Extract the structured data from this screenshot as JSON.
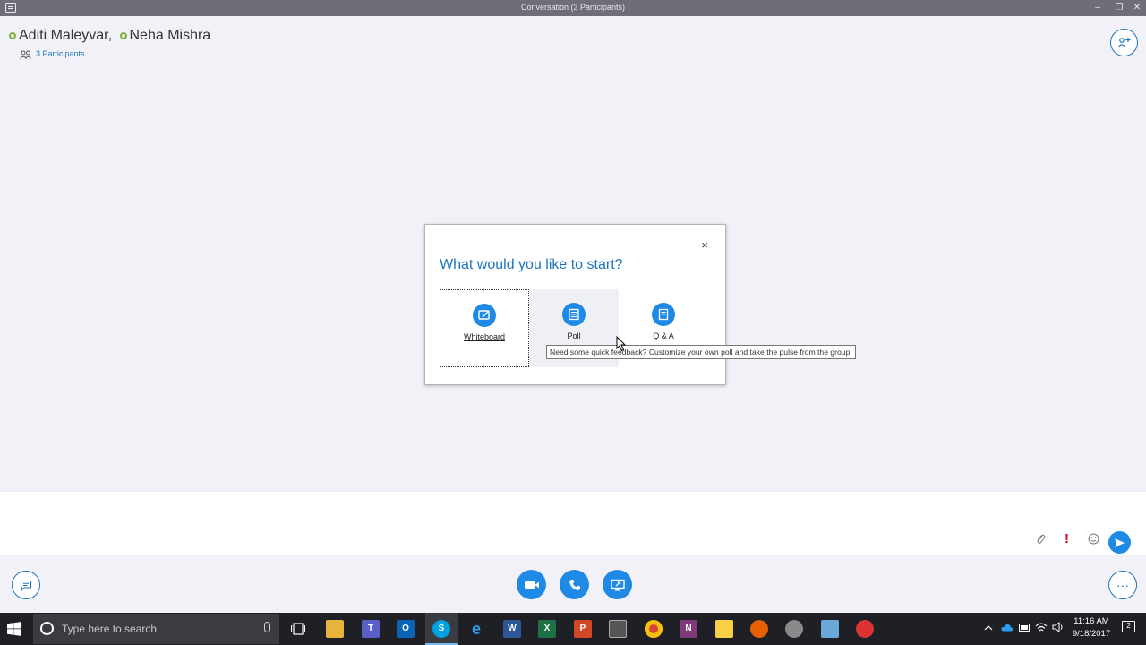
{
  "window": {
    "title": "Conversation (3 Participants)",
    "controls": {
      "minimize": "–",
      "restore": "❐",
      "close": "✕"
    }
  },
  "header": {
    "participants": [
      {
        "name": "Aditi Maleyvar,",
        "status_color": "#7db13a"
      },
      {
        "name": "Neha Mishra",
        "status_color": "#7db13a"
      }
    ],
    "participants_link": "3 Participants",
    "add_person_icon": "add-person-icon"
  },
  "dialog": {
    "heading": "What would you like to start?",
    "close_label": "×",
    "options": [
      {
        "label": "Whiteboard",
        "icon": "whiteboard-icon",
        "state": "focused"
      },
      {
        "label": "Poll",
        "icon": "poll-icon",
        "state": "hovered"
      },
      {
        "label": "Q & A",
        "icon": "qa-icon",
        "state": "normal"
      }
    ],
    "tooltip": "Need some quick feedback? Customize your own poll and take the pulse from the group."
  },
  "compose": {
    "attach_icon": "paperclip-icon",
    "important_label": "!",
    "emoji_icon": "emoji-icon",
    "send_icon": "send-icon"
  },
  "controls": {
    "more_label": "···",
    "buttons": [
      "video-icon",
      "call-icon",
      "share-screen-icon"
    ]
  },
  "taskbar": {
    "search_placeholder": "Type here to search",
    "apps": [
      "task-view",
      "file-explorer",
      "teams",
      "outlook",
      "skype",
      "edge",
      "word",
      "excel",
      "powerpoint",
      "calculator",
      "chrome",
      "onenote",
      "sticky-notes",
      "firefox",
      "paint",
      "app",
      "snipping-tool"
    ],
    "time": "11:16 AM",
    "date": "9/18/2017",
    "notification_count": "2"
  },
  "colors": {
    "accent": "#1e8ae5",
    "link": "#1c75bc",
    "presence": "#7db13a",
    "background": "#f3f1f8"
  }
}
